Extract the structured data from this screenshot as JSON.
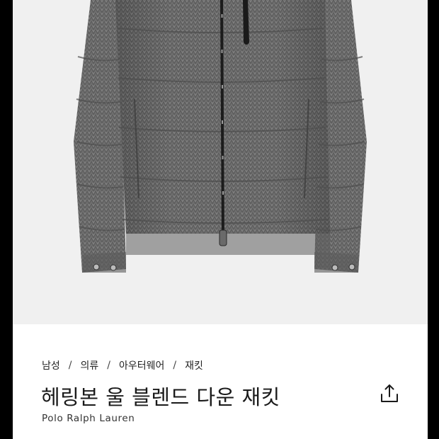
{
  "product": {
    "image_alt": "헤링본 울 블렌드 다운 재킷",
    "breadcrumb": [
      {
        "label": "남성"
      },
      {
        "label": "의류"
      },
      {
        "label": "아우터웨어"
      },
      {
        "label": "재킷"
      }
    ],
    "breadcrumb_separator": "/",
    "title": "헤링본 울 블렌드 다운 재킷",
    "brand": "Polo Ralph Lauren"
  },
  "icons": {
    "share": "share-icon"
  },
  "colors": {
    "hero_background": "#f0f0f0",
    "jacket_gray": "#6f6f6f",
    "text": "#1a1a1a",
    "frame": "#000000"
  }
}
